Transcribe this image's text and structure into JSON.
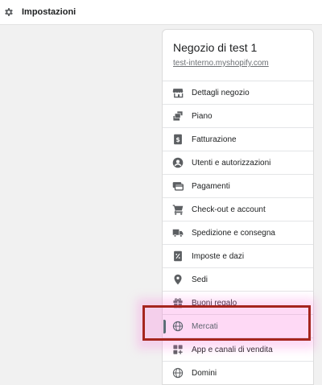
{
  "topbar": {
    "title": "Impostazioni"
  },
  "store": {
    "name": "Negozio di test 1",
    "url": "test-interno.myshopify.com"
  },
  "nav": [
    {
      "label": "Dettagli negozio",
      "icon": "store-icon"
    },
    {
      "label": "Piano",
      "icon": "plan-icon"
    },
    {
      "label": "Fatturazione",
      "icon": "billing-icon"
    },
    {
      "label": "Utenti e autorizzazioni",
      "icon": "user-icon"
    },
    {
      "label": "Pagamenti",
      "icon": "payments-icon"
    },
    {
      "label": "Check-out e account",
      "icon": "cart-icon"
    },
    {
      "label": "Spedizione e consegna",
      "icon": "truck-icon"
    },
    {
      "label": "Imposte e dazi",
      "icon": "tax-icon"
    },
    {
      "label": "Sedi",
      "icon": "location-icon"
    },
    {
      "label": "Buoni regalo",
      "icon": "gift-icon"
    },
    {
      "label": "Mercati",
      "icon": "globe-icon",
      "active": true
    },
    {
      "label": "App e canali di vendita",
      "icon": "apps-icon"
    },
    {
      "label": "Domini",
      "icon": "domain-globe-icon"
    }
  ],
  "colors": {
    "active_text": "#1f5c45",
    "active_bar": "#1f6b4f",
    "highlight_border": "#a5261e"
  }
}
